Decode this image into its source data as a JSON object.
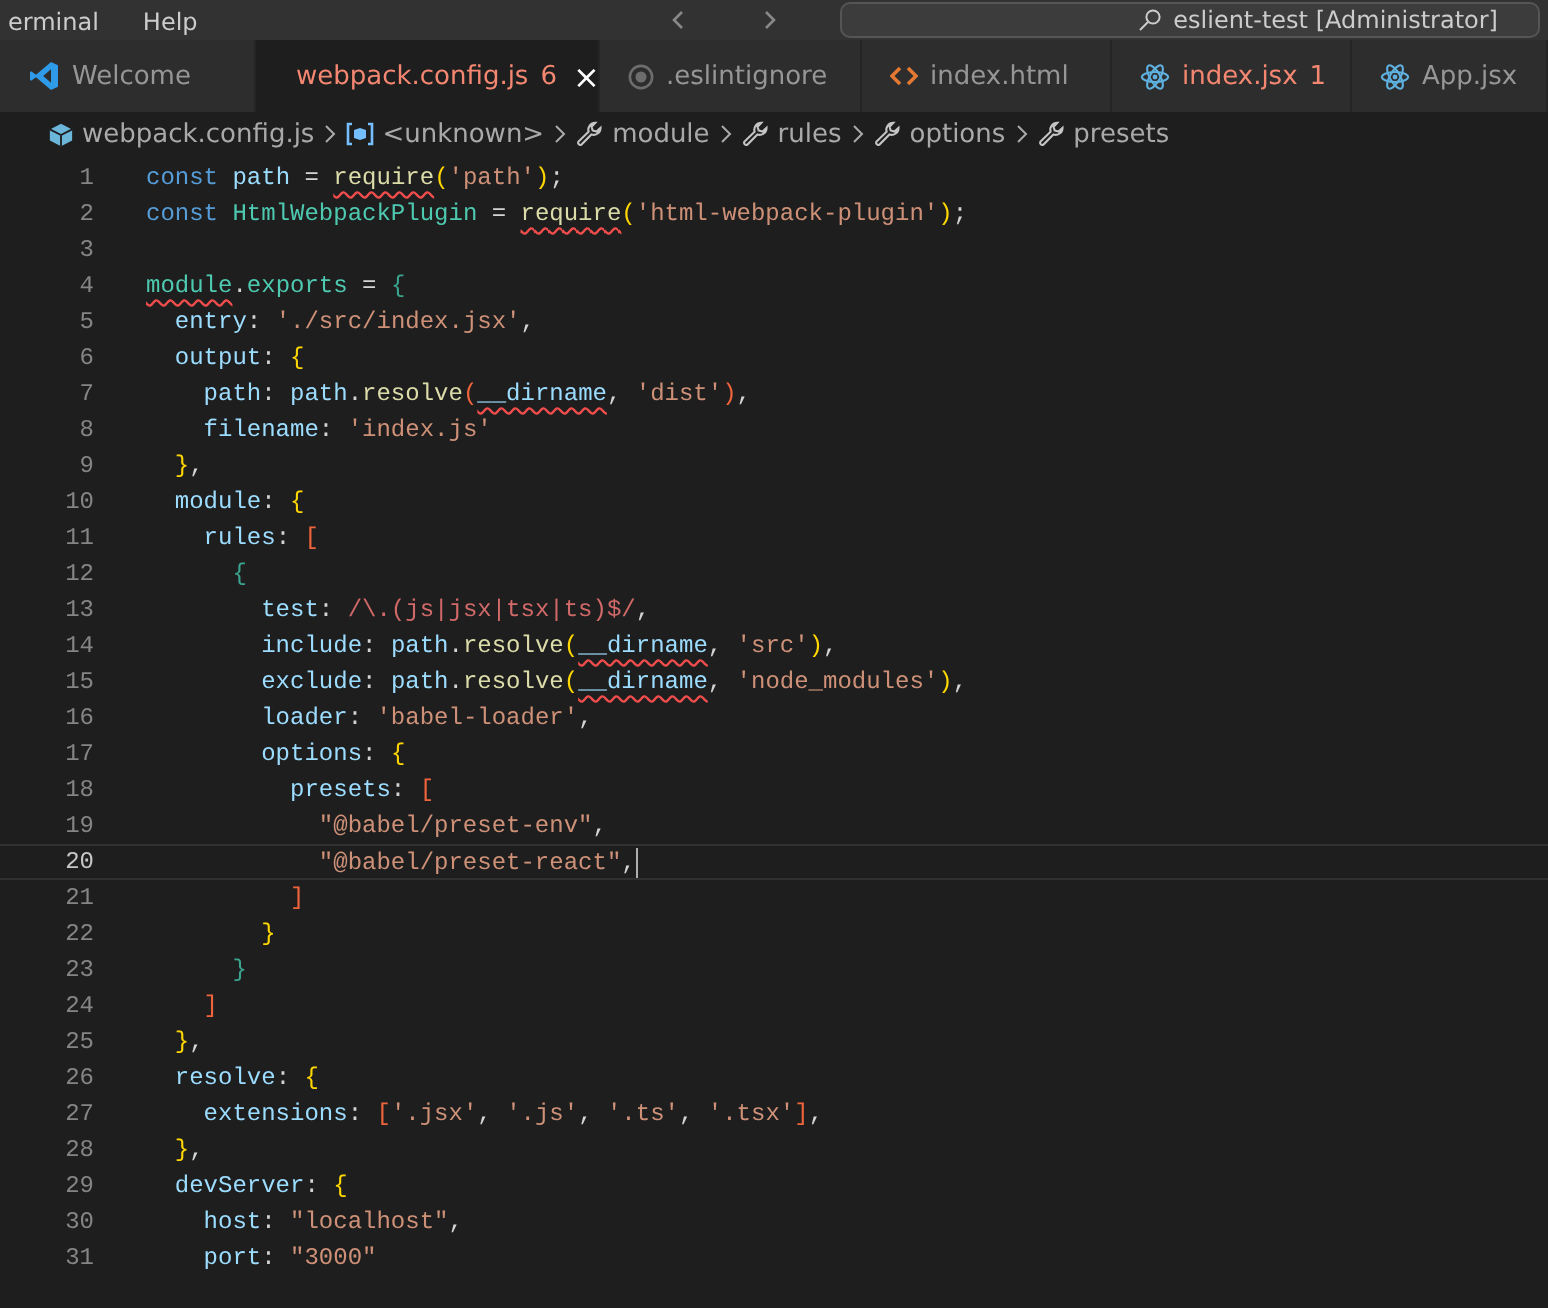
{
  "menu": [
    "erminal",
    "Help"
  ],
  "title_search": "eslient-test [Administrator]",
  "tabs": [
    {
      "label": "Welcome",
      "selected": false
    },
    {
      "label": "webpack.config.js",
      "selected": true,
      "problems": "6",
      "close": "×"
    },
    {
      "label": ".eslintignore",
      "selected": false
    },
    {
      "label": "index.html",
      "selected": false
    },
    {
      "label": "index.jsx",
      "selected": false,
      "problems": "1"
    },
    {
      "label": "App.jsx",
      "selected": false
    }
  ],
  "breadcrumbs": [
    "webpack.config.js",
    "<unknown>",
    "module",
    "rules",
    "options",
    "presets"
  ],
  "lines": [
    {
      "n": "1",
      "current": false,
      "tokens": [
        {
          "text": "const ",
          "kind": "kw"
        },
        {
          "text": "path",
          "kind": "var"
        },
        {
          "text": " = ",
          "kind": "op"
        },
        {
          "text": "require",
          "kind": "fn",
          "error": true
        },
        {
          "text": "(",
          "kind": "b1"
        },
        {
          "text": "'path'",
          "kind": "str"
        },
        {
          "text": ")",
          "kind": "b1"
        },
        {
          "text": ";",
          "kind": "op"
        }
      ]
    },
    {
      "n": "2",
      "current": false,
      "tokens": [
        {
          "text": "const ",
          "kind": "kw"
        },
        {
          "text": "HtmlWebpackPlugin",
          "kind": "cls"
        },
        {
          "text": " = ",
          "kind": "op"
        },
        {
          "text": "require",
          "kind": "fn",
          "error": true
        },
        {
          "text": "(",
          "kind": "b1"
        },
        {
          "text": "'html-webpack-plugin'",
          "kind": "str"
        },
        {
          "text": ")",
          "kind": "b1"
        },
        {
          "text": ";",
          "kind": "op"
        }
      ]
    },
    {
      "n": "3",
      "current": false
    },
    {
      "n": "4",
      "current": false,
      "tokens": [
        {
          "text": "module",
          "kind": "cls",
          "error": true
        },
        {
          "text": ".",
          "kind": "op"
        },
        {
          "text": "exports",
          "kind": "cls"
        },
        {
          "text": " = ",
          "kind": "op"
        },
        {
          "text": "{",
          "kind": "b3"
        }
      ]
    },
    {
      "n": "5",
      "current": false,
      "tokens": [
        {
          "text": "  entry",
          "kind": "var"
        },
        {
          "text": ": ",
          "kind": "op"
        },
        {
          "text": "'./src/index.jsx'",
          "kind": "str"
        },
        {
          "text": ",",
          "kind": "op"
        }
      ]
    },
    {
      "n": "6",
      "current": false,
      "tokens": [
        {
          "text": "  output",
          "kind": "var"
        },
        {
          "text": ": ",
          "kind": "op"
        },
        {
          "text": "{",
          "kind": "b1"
        }
      ]
    },
    {
      "n": "7",
      "current": false,
      "tokens": [
        {
          "text": "    path",
          "kind": "var"
        },
        {
          "text": ": ",
          "kind": "op"
        },
        {
          "text": "path",
          "kind": "var"
        },
        {
          "text": ".",
          "kind": "op"
        },
        {
          "text": "resolve",
          "kind": "fn"
        },
        {
          "text": "(",
          "kind": "b2"
        },
        {
          "text": "__dirname",
          "kind": "var",
          "error": true
        },
        {
          "text": ", ",
          "kind": "op"
        },
        {
          "text": "'dist'",
          "kind": "str"
        },
        {
          "text": ")",
          "kind": "b2"
        },
        {
          "text": ",",
          "kind": "op"
        }
      ]
    },
    {
      "n": "8",
      "current": false,
      "tokens": [
        {
          "text": "    filename",
          "kind": "var"
        },
        {
          "text": ": ",
          "kind": "op"
        },
        {
          "text": "'index.js'",
          "kind": "str"
        }
      ]
    },
    {
      "n": "9",
      "current": false,
      "tokens": [
        {
          "text": "  }",
          "kind": "b1"
        },
        {
          "text": ",",
          "kind": "op"
        }
      ]
    },
    {
      "n": "10",
      "current": false,
      "tokens": [
        {
          "text": "  module",
          "kind": "var"
        },
        {
          "text": ": ",
          "kind": "op"
        },
        {
          "text": "{",
          "kind": "b1"
        }
      ]
    },
    {
      "n": "11",
      "current": false,
      "tokens": [
        {
          "text": "    rules",
          "kind": "var"
        },
        {
          "text": ": ",
          "kind": "op"
        },
        {
          "text": "[",
          "kind": "b2"
        }
      ]
    },
    {
      "n": "12",
      "current": false,
      "tokens": [
        {
          "text": "      {",
          "kind": "b3"
        }
      ]
    },
    {
      "n": "13",
      "current": false,
      "tokens": [
        {
          "text": "        test",
          "kind": "var"
        },
        {
          "text": ": ",
          "kind": "op"
        },
        {
          "text": "/\\.(js|jsx|tsx|ts)$/",
          "kind": "re"
        },
        {
          "text": ",",
          "kind": "op"
        }
      ]
    },
    {
      "n": "14",
      "current": false,
      "tokens": [
        {
          "text": "        include",
          "kind": "var"
        },
        {
          "text": ": ",
          "kind": "op"
        },
        {
          "text": "path",
          "kind": "var"
        },
        {
          "text": ".",
          "kind": "op"
        },
        {
          "text": "resolve",
          "kind": "fn"
        },
        {
          "text": "(",
          "kind": "b1"
        },
        {
          "text": "__dirname",
          "kind": "var",
          "error": true
        },
        {
          "text": ", ",
          "kind": "op"
        },
        {
          "text": "'src'",
          "kind": "str"
        },
        {
          "text": ")",
          "kind": "b1"
        },
        {
          "text": ",",
          "kind": "op"
        }
      ]
    },
    {
      "n": "15",
      "current": false,
      "tokens": [
        {
          "text": "        exclude",
          "kind": "var"
        },
        {
          "text": ": ",
          "kind": "op"
        },
        {
          "text": "path",
          "kind": "var"
        },
        {
          "text": ".",
          "kind": "op"
        },
        {
          "text": "resolve",
          "kind": "fn"
        },
        {
          "text": "(",
          "kind": "b1"
        },
        {
          "text": "__dirname",
          "kind": "var",
          "error": true
        },
        {
          "text": ", ",
          "kind": "op"
        },
        {
          "text": "'node_modules'",
          "kind": "str"
        },
        {
          "text": ")",
          "kind": "b1"
        },
        {
          "text": ",",
          "kind": "op"
        }
      ]
    },
    {
      "n": "16",
      "current": false,
      "tokens": [
        {
          "text": "        loader",
          "kind": "var"
        },
        {
          "text": ": ",
          "kind": "op"
        },
        {
          "text": "'babel-loader'",
          "kind": "str"
        },
        {
          "text": ",",
          "kind": "op"
        }
      ]
    },
    {
      "n": "17",
      "current": false,
      "tokens": [
        {
          "text": "        options",
          "kind": "var"
        },
        {
          "text": ": ",
          "kind": "op"
        },
        {
          "text": "{",
          "kind": "b1"
        }
      ]
    },
    {
      "n": "18",
      "current": false,
      "tokens": [
        {
          "text": "          presets",
          "kind": "var"
        },
        {
          "text": ": ",
          "kind": "op"
        },
        {
          "text": "[",
          "kind": "b2"
        }
      ]
    },
    {
      "n": "19",
      "current": false,
      "tokens": [
        {
          "text": "            \"@babel/preset-env\"",
          "kind": "str"
        },
        {
          "text": ",",
          "kind": "op"
        }
      ]
    },
    {
      "n": "20",
      "current": true,
      "tokens": [
        {
          "text": "            \"@babel/preset-react\"",
          "kind": "str"
        },
        {
          "text": ",",
          "kind": "op"
        }
      ]
    },
    {
      "n": "21",
      "current": false,
      "tokens": [
        {
          "text": "          ]",
          "kind": "b2"
        }
      ]
    },
    {
      "n": "22",
      "current": false,
      "tokens": [
        {
          "text": "        }",
          "kind": "b1"
        }
      ]
    },
    {
      "n": "23",
      "current": false,
      "tokens": [
        {
          "text": "      }",
          "kind": "b3"
        }
      ]
    },
    {
      "n": "24",
      "current": false,
      "tokens": [
        {
          "text": "    ]",
          "kind": "b2"
        }
      ]
    },
    {
      "n": "25",
      "current": false,
      "tokens": [
        {
          "text": "  }",
          "kind": "b1"
        },
        {
          "text": ",",
          "kind": "op"
        }
      ]
    },
    {
      "n": "26",
      "current": false,
      "tokens": [
        {
          "text": "  resolve",
          "kind": "var"
        },
        {
          "text": ": ",
          "kind": "op"
        },
        {
          "text": "{",
          "kind": "b1"
        }
      ]
    },
    {
      "n": "27",
      "current": false,
      "tokens": [
        {
          "text": "    extensions",
          "kind": "var"
        },
        {
          "text": ": ",
          "kind": "op"
        },
        {
          "text": "[",
          "kind": "b2"
        },
        {
          "text": "'.jsx'",
          "kind": "str"
        },
        {
          "text": ", ",
          "kind": "op"
        },
        {
          "text": "'.js'",
          "kind": "str"
        },
        {
          "text": ", ",
          "kind": "op"
        },
        {
          "text": "'.ts'",
          "kind": "str"
        },
        {
          "text": ", ",
          "kind": "op"
        },
        {
          "text": "'.tsx'",
          "kind": "str"
        },
        {
          "text": "]",
          "kind": "b2"
        },
        {
          "text": ",",
          "kind": "op"
        }
      ]
    },
    {
      "n": "28",
      "current": false,
      "tokens": [
        {
          "text": "  }",
          "kind": "b1"
        },
        {
          "text": ",",
          "kind": "op"
        }
      ]
    },
    {
      "n": "29",
      "current": false,
      "tokens": [
        {
          "text": "  devServer",
          "kind": "var"
        },
        {
          "text": ": ",
          "kind": "op"
        },
        {
          "text": "{",
          "kind": "b1"
        }
      ]
    },
    {
      "n": "30",
      "current": false,
      "tokens": [
        {
          "text": "    host",
          "kind": "var"
        },
        {
          "text": ": ",
          "kind": "op"
        },
        {
          "text": "\"localhost\"",
          "kind": "str"
        },
        {
          "text": ",",
          "kind": "op"
        }
      ]
    },
    {
      "n": "31",
      "current": false,
      "tokens": [
        {
          "text": "    port",
          "kind": "var"
        },
        {
          "text": ": ",
          "kind": "op"
        },
        {
          "text": "\"3000\"",
          "kind": "str"
        }
      ]
    }
  ]
}
